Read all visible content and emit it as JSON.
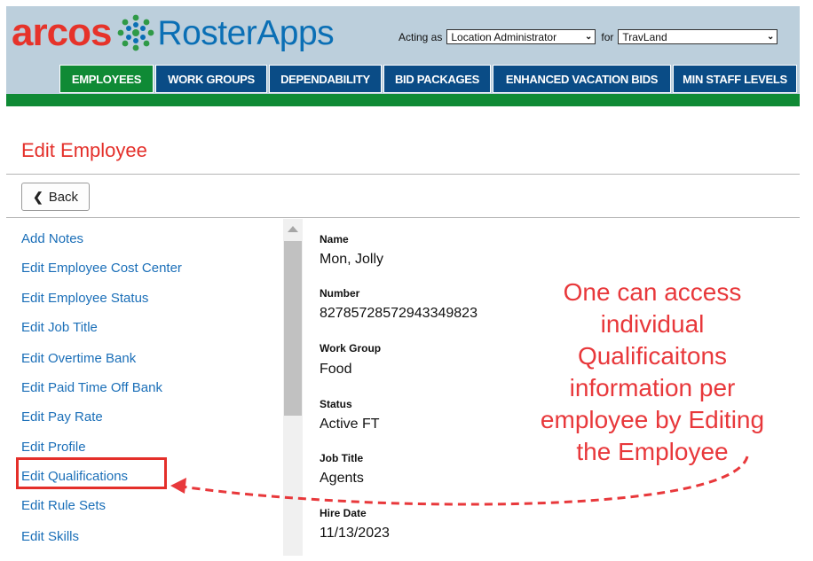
{
  "logo": {
    "brand": "arcos",
    "product": "RosterApps"
  },
  "acting": {
    "acting_label": "Acting as",
    "role_value": "Location Administrator",
    "for_label": "for",
    "location_value": "TravLand"
  },
  "tabs": [
    {
      "label": "EMPLOYEES",
      "active": true
    },
    {
      "label": "WORK GROUPS",
      "active": false
    },
    {
      "label": "DEPENDABILITY",
      "active": false
    },
    {
      "label": "BID PACKAGES",
      "active": false
    },
    {
      "label": "ENHANCED VACATION BIDS",
      "active": false
    },
    {
      "label": "MIN STAFF LEVELS",
      "active": false
    }
  ],
  "page": {
    "title": "Edit Employee",
    "back_label": "Back"
  },
  "menu": {
    "items": [
      "Add Notes",
      "Edit Employee Cost Center",
      "Edit Employee Status",
      "Edit Job Title",
      "Edit Overtime Bank",
      "Edit Paid Time Off Bank",
      "Edit Pay Rate",
      "Edit Profile",
      "Edit Qualifications",
      "Edit Rule Sets",
      "Edit Skills"
    ]
  },
  "employee": {
    "name_label": "Name",
    "name": "Mon, Jolly",
    "number_label": "Number",
    "number": "82785728572943349823",
    "work_group_label": "Work Group",
    "work_group": "Food",
    "status_label": "Status",
    "status": "Active FT",
    "job_title_label": "Job Title",
    "job_title": "Agents",
    "hire_date_label": "Hire Date",
    "hire_date": "11/13/2023"
  },
  "annotation": {
    "lines": [
      "One can access",
      "individual",
      "Qualificaitons",
      "information per",
      "employee by Editing",
      "the Employee"
    ]
  },
  "colors": {
    "header_bg": "#bccfdc",
    "tab_blue": "#0a4c86",
    "tab_green": "#0f8a35",
    "title_red": "#e42f2a",
    "link_blue": "#1b6fb8",
    "annotation_red": "#e8383b"
  }
}
